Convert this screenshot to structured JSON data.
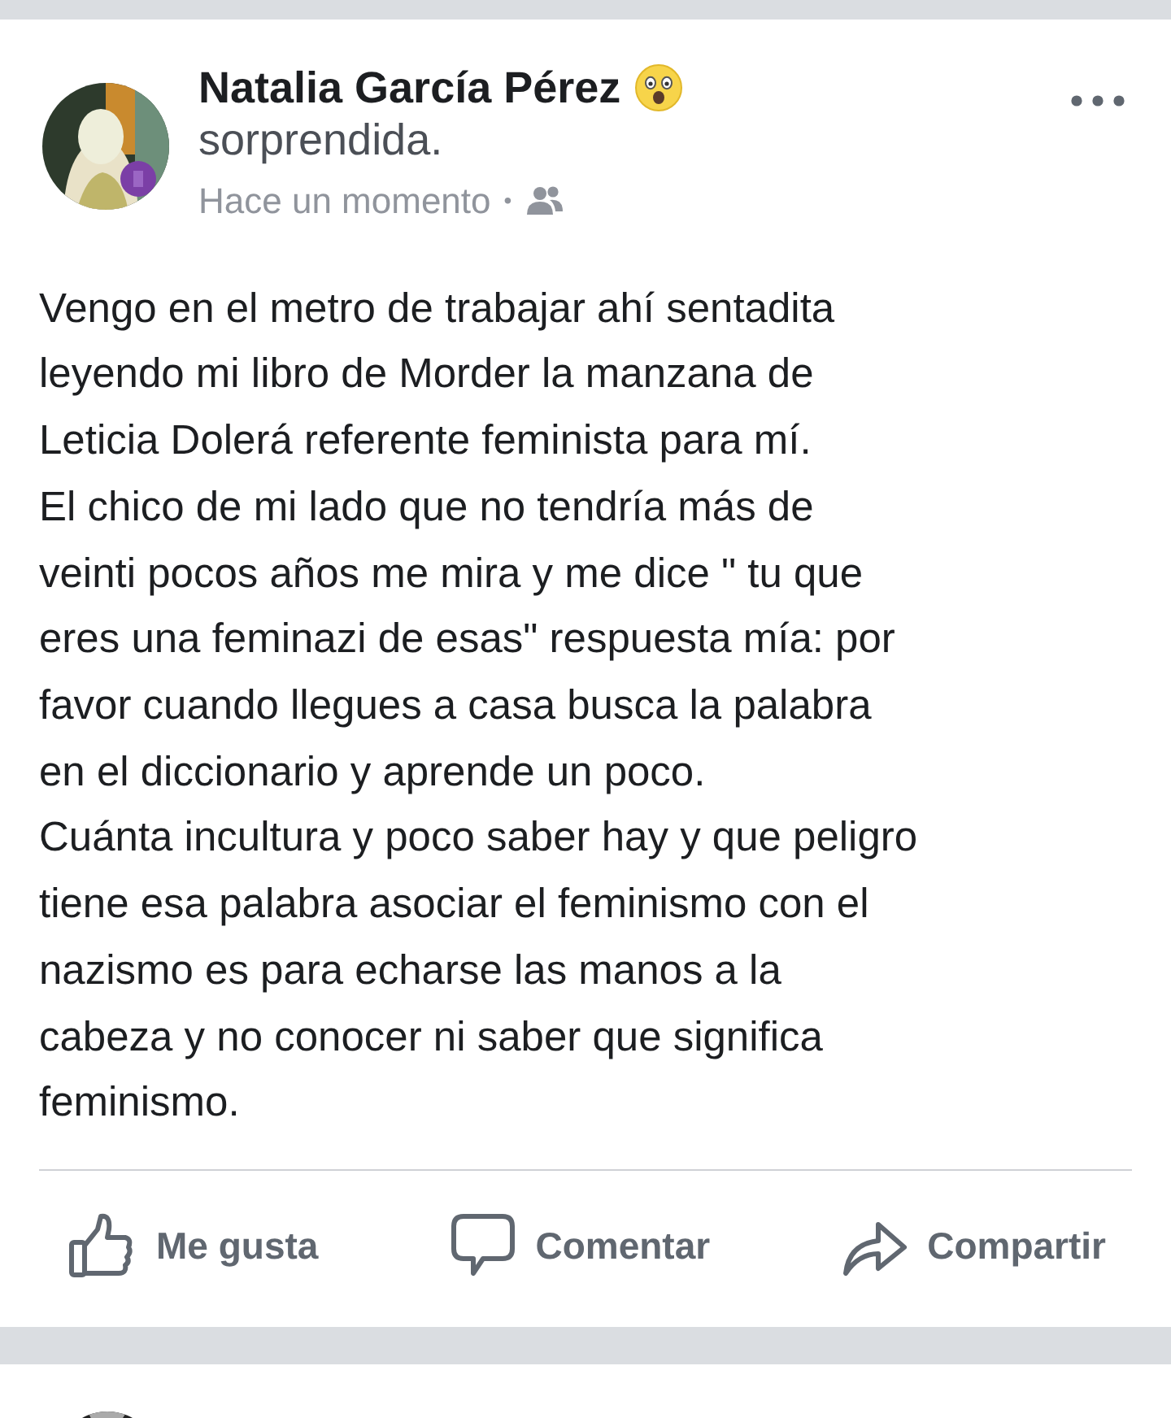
{
  "post": {
    "author": "Natalia García Pérez",
    "feeling": "sorprendida.",
    "time": "Hace un momento",
    "separator": "•",
    "paragraphs": [
      "Vengo en el metro de trabajar ahí sentadita\nleyendo mi libro de Morder la manzana de\nLeticia Dolerá referente feminista para mí.",
      "El chico de mi lado que no tendría más de\nveinti pocos años me mira y me dice \" tu que\neres una feminazi de esas\" respuesta mía: por\nfavor cuando llegues a casa busca la palabra\nen el diccionario y aprende un poco.",
      "Cuánta incultura y poco saber hay y que peligro\ntiene esa palabra asociar el feminismo con el\nnazismo es para echarse las manos a la\ncabeza y no conocer ni saber que significa\nfeminismo."
    ],
    "actions": [
      {
        "kind": "like",
        "label": "Me gusta"
      },
      {
        "kind": "comment",
        "label": "Comentar"
      },
      {
        "kind": "share",
        "label": "Compartir"
      }
    ]
  }
}
